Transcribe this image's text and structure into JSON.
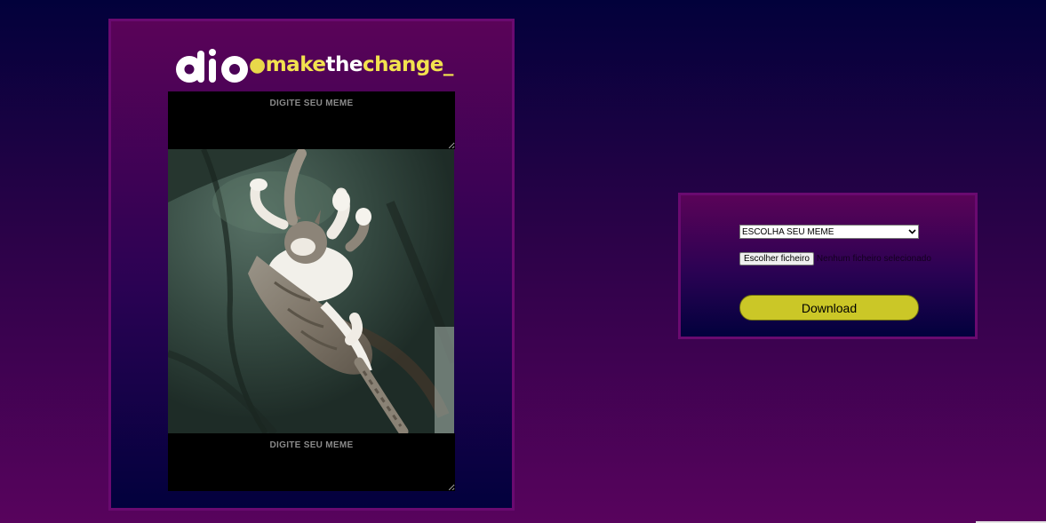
{
  "brand": {
    "logo_mark": "dio",
    "tagline": {
      "dot": "●",
      "make": "make",
      "the": "the",
      "change": "change",
      "underscore": "_"
    }
  },
  "meme_editor": {
    "top_text_placeholder": "DIGITE SEU MEME",
    "bottom_text_placeholder": "DIGITE SEU MEME",
    "image": "cat-sleeping-on-leather-sofa-photo"
  },
  "controls": {
    "select_value": "ESCOLHA SEU MEME",
    "select_arrow_icon": "chevron-down-icon",
    "file_button_label": "Escolher ficheiro",
    "file_status": "Nenhum ficheiro selecionado",
    "download_label": "Download"
  },
  "colors": {
    "accent_yellow": "#cbc727",
    "tagline_yellow": "#f2e24e",
    "panel_border": "#6a0a70",
    "background_top": "#02013b",
    "background_bottom": "#58035d"
  }
}
